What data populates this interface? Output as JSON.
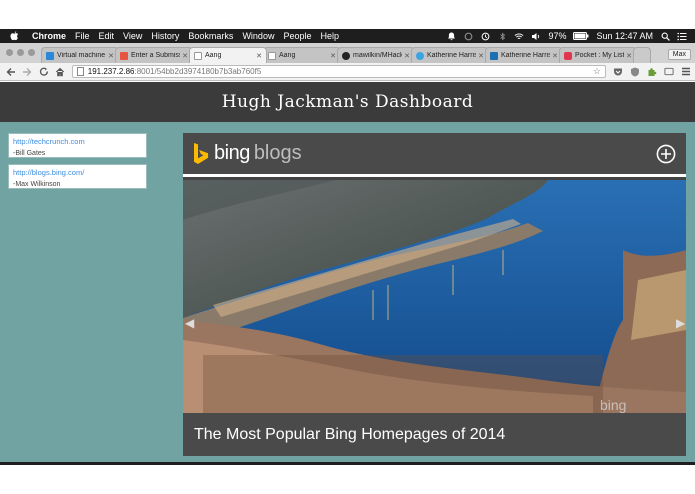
{
  "menubar": {
    "app": "Chrome",
    "items": [
      "File",
      "Edit",
      "View",
      "History",
      "Bookmarks",
      "Window",
      "People",
      "Help"
    ],
    "battery": "97%",
    "clock": "Sun 12:47 AM"
  },
  "tabs": [
    {
      "label": "Virtual machine",
      "color": "#2b88d8"
    },
    {
      "label": "Enter a Submiss",
      "color": "#e8553f"
    },
    {
      "label": "Aang",
      "color": "#ffffff"
    },
    {
      "label": "Aang",
      "color": "#ffffff"
    },
    {
      "label": "mawilkin/MHack",
      "color": "#222222"
    },
    {
      "label": "Katherine Harris",
      "color": "#3aa3e3"
    },
    {
      "label": "Katherine Harris",
      "color": "#1d6fb0"
    },
    {
      "label": "Pocket : My List",
      "color": "#e0374f"
    }
  ],
  "profile": "Max",
  "address": {
    "host": "191.237.2.86",
    "path": ":8001/54bb2d3974180b7b3ab760f5"
  },
  "page": {
    "title": "Hugh Jackman's Dashboard",
    "quotes": [
      {
        "url": "http://techcrunch.com",
        "author": "-Bill Gates"
      },
      {
        "url": "http://blogs.bing.com/",
        "author": "-Max Wilkinson"
      }
    ],
    "card": {
      "brand": "bing",
      "section": "blogs",
      "headline": "The Most Popular Bing Homepages of 2014",
      "watermark": "bing"
    }
  },
  "colors": {
    "page_bg": "#71a3a3",
    "header_bg": "#3b3b3b",
    "bing_yellow": "#ffb900"
  }
}
